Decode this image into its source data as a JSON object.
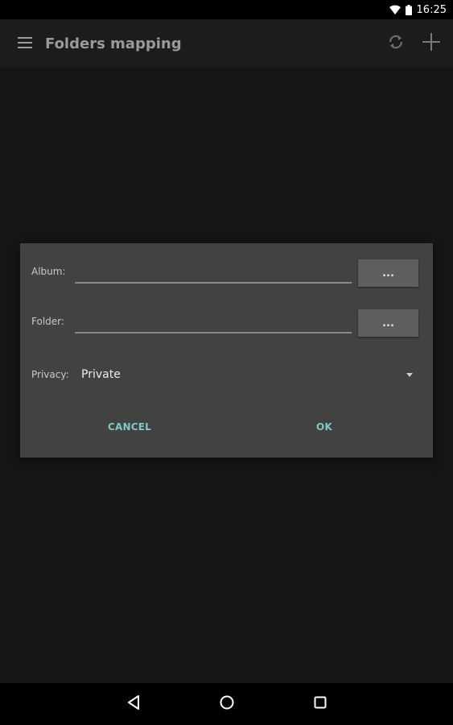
{
  "status_bar": {
    "time": "16:25",
    "icons": [
      "wifi-icon",
      "battery-icon"
    ]
  },
  "app_bar": {
    "title": "Folders mapping",
    "icons": [
      "menu-icon",
      "sync-icon",
      "add-icon"
    ]
  },
  "dialog": {
    "album_label": "Album:",
    "album_value": "",
    "album_browse_label": "...",
    "folder_label": "Folder:",
    "folder_value": "",
    "folder_browse_label": "...",
    "privacy_label": "Privacy:",
    "privacy_value": "Private",
    "cancel_label": "CANCEL",
    "ok_label": "OK"
  },
  "nav_bar": {
    "icons": [
      "back-icon",
      "home-icon",
      "recents-icon"
    ]
  },
  "colors": {
    "accent": "#7fcbc4",
    "background": "#161616",
    "dialog": "#424242"
  }
}
